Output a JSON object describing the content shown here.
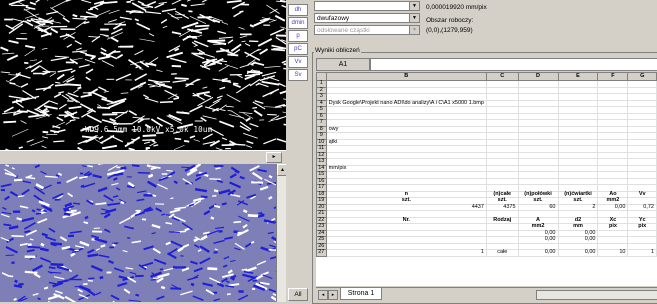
{
  "image_top": {
    "overlay_text": "WD9.6 5mm 10.0kV x5.0k 10um"
  },
  "side_buttons": [
    "dh",
    "dmin",
    "p",
    "pC",
    "Vv",
    "Sv"
  ],
  "all_button": "All",
  "controls": {
    "combo1_value": "",
    "combo2_value": "dwufazowy",
    "combo3_value": "odsłowane cząstki",
    "scale_label": "0,000019920 mm/pix",
    "work_area_label": "Obszar roboczy:",
    "work_area_value": "(0,0),(1279,959)"
  },
  "results": {
    "label": "Wyniki obliczeń",
    "cell_ref": "A1",
    "formula": "",
    "columns": [
      "B",
      "C",
      "D",
      "E",
      "F",
      "G"
    ],
    "rows": [
      {
        "n": "1",
        "cells": [
          "",
          "",
          "",
          "",
          "",
          ""
        ]
      },
      {
        "n": "2",
        "cells": [
          "",
          "",
          "",
          "",
          "",
          ""
        ]
      },
      {
        "n": "3",
        "cells": [
          "",
          "",
          "",
          "",
          "",
          ""
        ]
      },
      {
        "n": "4",
        "cells": [
          "Dysk Google\\Projekt nano ADI\\do analizy\\A i C\\A1 x5000 1.bmp",
          "",
          "",
          "",
          "",
          ""
        ]
      },
      {
        "n": "5",
        "cells": [
          "",
          "",
          "",
          "",
          "",
          ""
        ]
      },
      {
        "n": "6",
        "cells": [
          "",
          "",
          "",
          "",
          "",
          ""
        ]
      },
      {
        "n": "7",
        "cells": [
          "",
          "",
          "",
          "",
          "",
          ""
        ]
      },
      {
        "n": "8",
        "cells": [
          "owy",
          "",
          "",
          "",
          "",
          ""
        ]
      },
      {
        "n": "9",
        "cells": [
          "",
          "",
          "",
          "",
          "",
          ""
        ]
      },
      {
        "n": "10",
        "cells": [
          "ątki",
          "",
          "",
          "",
          "",
          ""
        ]
      },
      {
        "n": "11",
        "cells": [
          "",
          "",
          "",
          "",
          "",
          ""
        ]
      },
      {
        "n": "12",
        "cells": [
          "",
          "",
          "",
          "",
          "",
          ""
        ]
      },
      {
        "n": "13",
        "cells": [
          "",
          "",
          "",
          "",
          "",
          ""
        ]
      },
      {
        "n": "14",
        "cells": [
          "mm/pix",
          "",
          "",
          "",
          "",
          ""
        ]
      },
      {
        "n": "15",
        "cells": [
          "",
          "",
          "",
          "",
          "",
          ""
        ]
      },
      {
        "n": "16",
        "cells": [
          "",
          "",
          "",
          "",
          "",
          ""
        ]
      },
      {
        "n": "17",
        "cells": [
          "",
          "",
          "",
          "",
          "",
          ""
        ]
      },
      {
        "n": "18",
        "cells": [
          "n",
          "(n)całe",
          "(n)połówki",
          "(n)ćwiartki",
          "Ao",
          "Vv"
        ]
      },
      {
        "n": "19",
        "cells": [
          "szt.",
          "szt.",
          "szt.",
          "szt.",
          "mm2",
          ""
        ]
      },
      {
        "n": "20",
        "cells": [
          "4437",
          "4375",
          "60",
          "2",
          "0,00",
          "0,72"
        ]
      },
      {
        "n": "21",
        "cells": [
          "",
          "",
          "",
          "",
          "",
          ""
        ]
      },
      {
        "n": "22",
        "cells": [
          "Nr.",
          "Rodzaj",
          "A",
          "d2",
          "Xc",
          "Yc"
        ]
      },
      {
        "n": "23",
        "cells": [
          "",
          "",
          "mm2",
          "mm",
          "pix",
          "pix"
        ]
      },
      {
        "n": "24",
        "cells": [
          "",
          "",
          "0,00",
          "0,00",
          "",
          ""
        ]
      },
      {
        "n": "25",
        "cells": [
          "",
          "",
          "0,00",
          "0,00",
          "",
          ""
        ]
      },
      {
        "n": "26",
        "cells": [
          "",
          "",
          "",
          "",
          "",
          ""
        ]
      },
      {
        "n": "27",
        "cells": [
          "1",
          "całe",
          "0,00",
          "0,00",
          "10",
          "1"
        ]
      }
    ]
  },
  "sheet_tab": "Strona 1",
  "colors": {
    "panel": "#d4d0c8",
    "overlay_blue": "#2a2ad8",
    "overlay_bg": "#7f7fb8"
  }
}
